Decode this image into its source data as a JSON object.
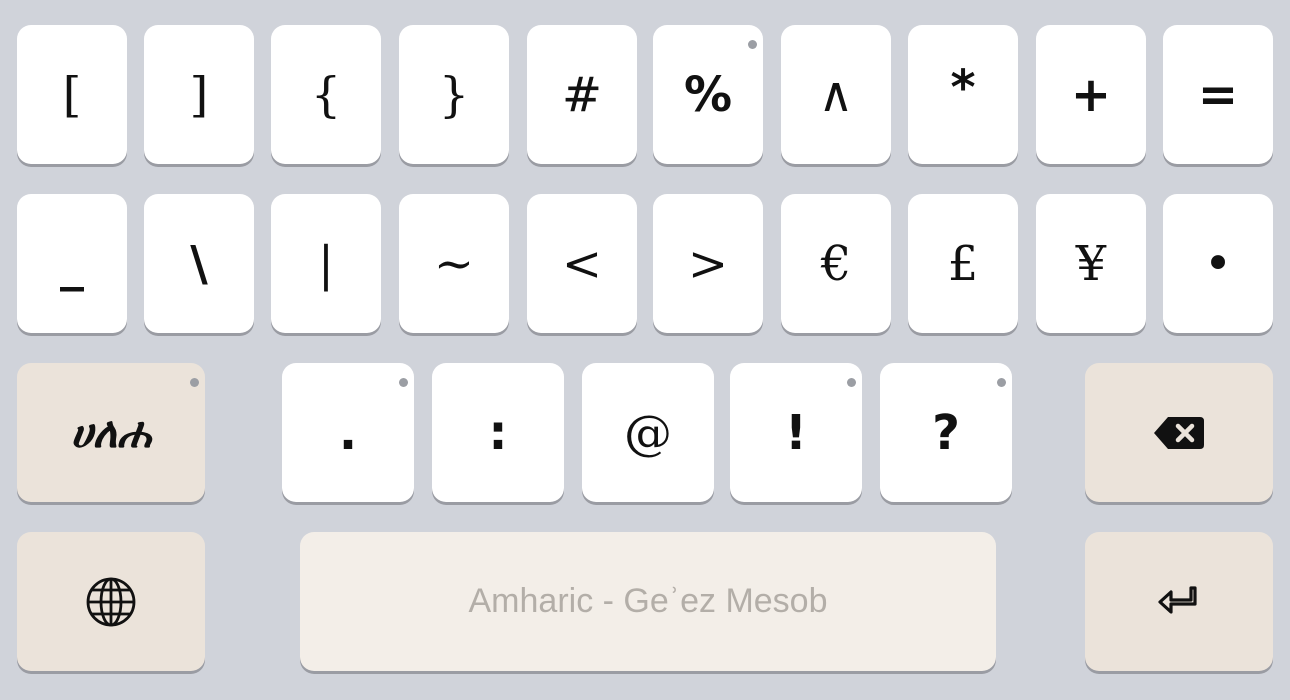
{
  "keyboard": {
    "row1": [
      "[",
      "]",
      "{",
      "}",
      "#",
      "%",
      "∧",
      "*",
      "+",
      "="
    ],
    "row2": [
      "_",
      "\\",
      "|",
      "~",
      "<",
      ">",
      "€",
      "£",
      "¥",
      "•"
    ],
    "row3_symbols": [
      ".",
      ":",
      "@",
      "!",
      "?"
    ],
    "mode_switch_label": "ሀለሐ",
    "space_label": "Amharic - Geʾez Mesob",
    "icons": {
      "backspace": "backspace-icon",
      "globe": "globe-icon",
      "enter": "return-arrow-icon"
    },
    "colors": {
      "background": "#d0d3da",
      "key": "#ffffff",
      "special_key": "#ebe3da",
      "space_key": "#f3eee8"
    }
  }
}
